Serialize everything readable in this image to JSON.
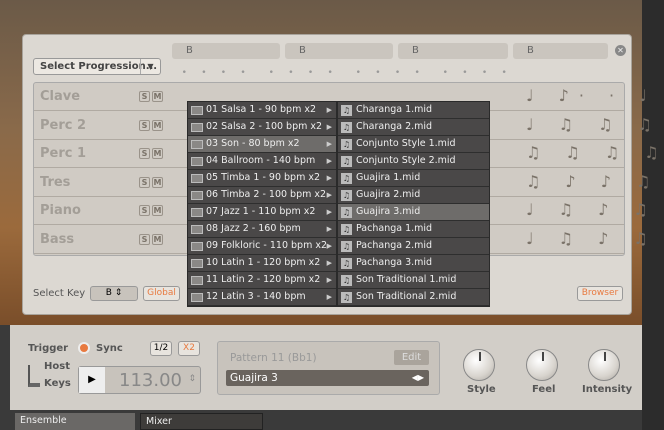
{
  "header": {
    "sections": [
      "B",
      "B",
      "B",
      "B"
    ],
    "select_progression": "Select Progression..."
  },
  "tracks": [
    {
      "name": "Clave",
      "solo": "S",
      "mute": "M",
      "notes": "♩ ♪· · ♩"
    },
    {
      "name": "Perc 2",
      "solo": "S",
      "mute": "M",
      "notes": "♩ ♫ ♫ ♫"
    },
    {
      "name": "Perc 1",
      "solo": "S",
      "mute": "M",
      "notes": "♫ ♫ ♫ ♫"
    },
    {
      "name": "Tres",
      "solo": "S",
      "mute": "M",
      "notes": "♫ ♪ ♪ ♫"
    },
    {
      "name": "Piano",
      "solo": "S",
      "mute": "M",
      "notes": "♩ ♫ ♪ ♫"
    },
    {
      "name": "Bass",
      "solo": "S",
      "mute": "M",
      "notes": "♩ ♫ ♪ ♫"
    }
  ],
  "folders": [
    "01 Salsa 1 - 90 bpm x2",
    "02 Salsa 2 - 100 bpm x2",
    "03 Son - 80 bpm x2",
    "04 Ballroom - 140 bpm",
    "05 Timba 1 - 90 bpm x2",
    "06 Timba 2 - 100 bpm x2",
    "07 Jazz 1 - 110 bpm x2",
    "08 Jazz 2 - 160 bpm",
    "09 Folkloric - 110 bpm x2",
    "10 Latin 1 - 120 bpm x2",
    "11 Latin 2 - 120 bpm x2",
    "12 Latin 3 - 140 bpm"
  ],
  "files": [
    "Charanga 1.mid",
    "Charanga 2.mid",
    "Conjunto Style 1.mid",
    "Conjunto Style 2.mid",
    "Guajira 1.mid",
    "Guajira 2.mid",
    "Guajira 3.mid",
    "Pachanga 1.mid",
    "Pachanga 2.mid",
    "Pachanga 3.mid",
    "Son Traditional 1.mid",
    "Son Traditional 2.mid"
  ],
  "key": {
    "label": "Select Key",
    "value": "B",
    "global": "Global",
    "browser": "Browser"
  },
  "controls": {
    "trigger": "Trigger",
    "sync": "Sync",
    "host": "Host",
    "keys": "Keys",
    "half": "1/2",
    "double": "X2",
    "tempo": "113.00",
    "pattern": "Pattern 11 (Bb1)",
    "edit": "Edit",
    "pattern_name": "Guajira 3",
    "knobs": [
      "Style",
      "Feel",
      "Intensity"
    ]
  },
  "tabs": [
    "Ensemble",
    "Mixer"
  ]
}
